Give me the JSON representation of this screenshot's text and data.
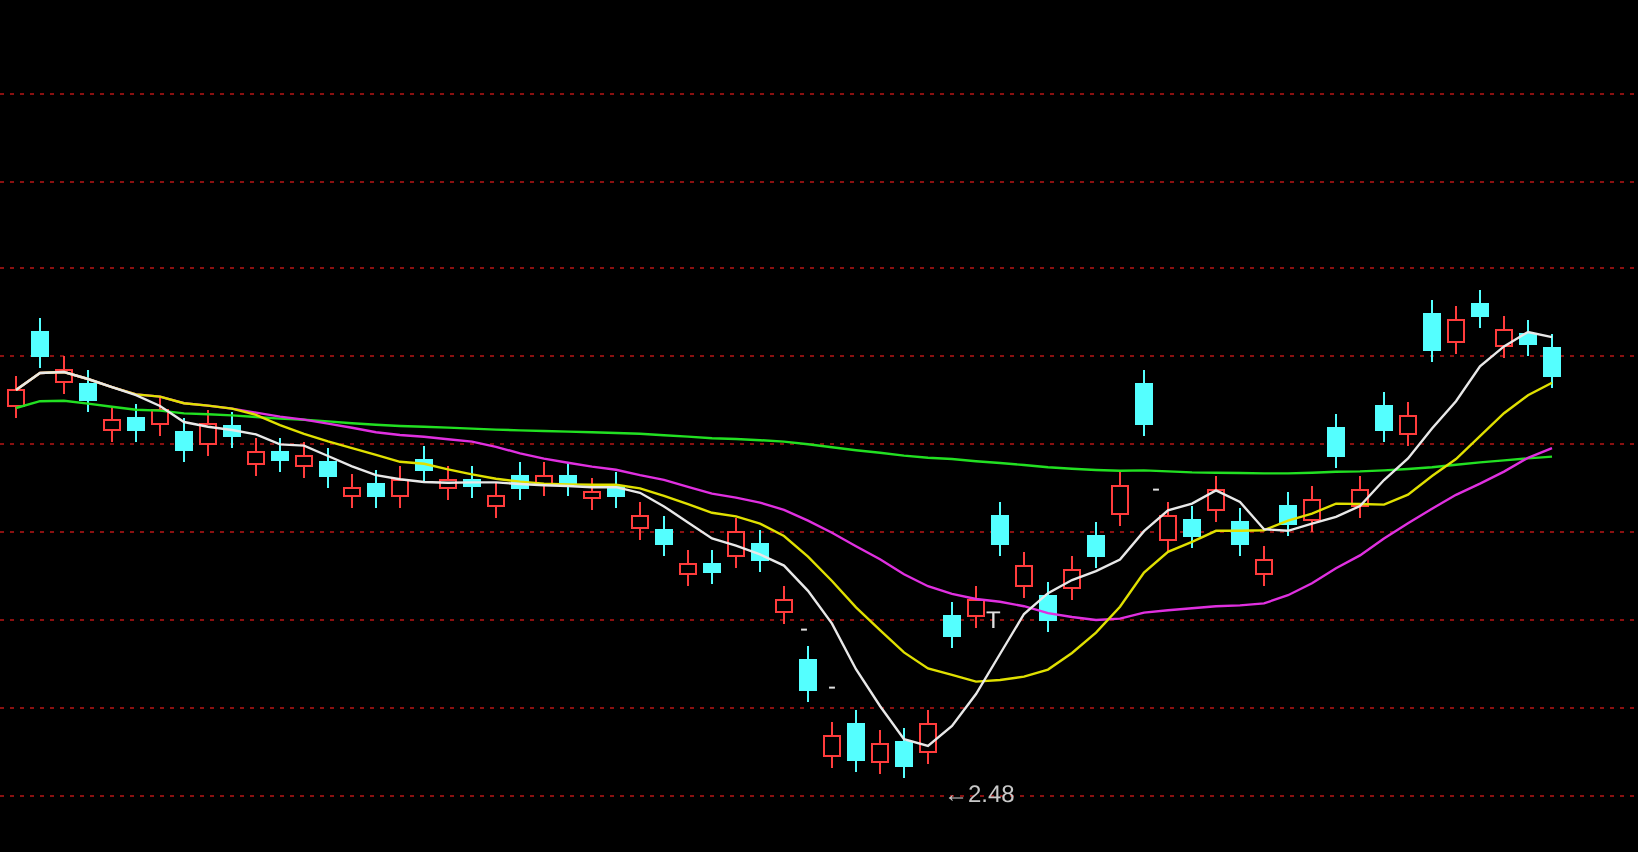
{
  "chart": {
    "low_label": "←2.48",
    "markers": [
      {
        "label": "-"
      },
      {
        "label": "-"
      },
      {
        "label": "T"
      },
      {
        "label": "-"
      }
    ]
  }
}
